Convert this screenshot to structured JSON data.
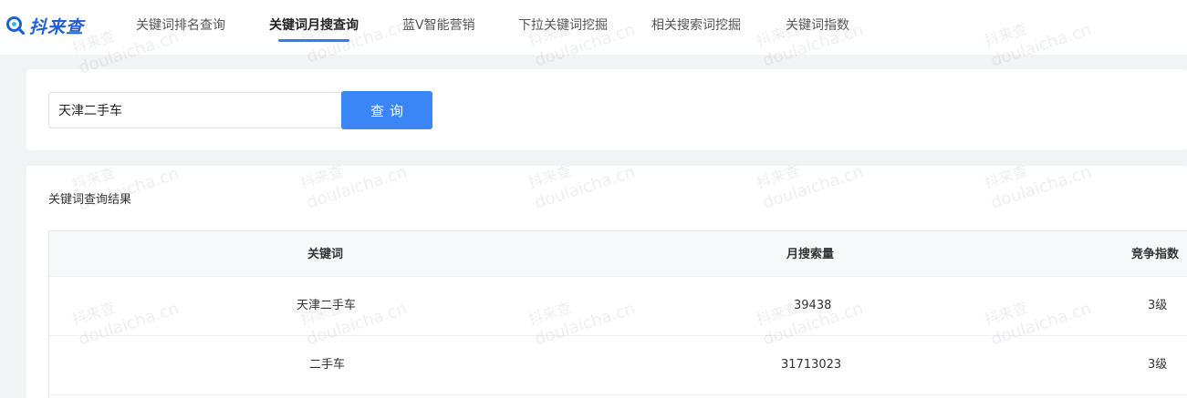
{
  "header": {
    "logo_text": "抖来查",
    "nav": [
      {
        "label": "关键词排名查询",
        "active": false
      },
      {
        "label": "关键词月搜查询",
        "active": true
      },
      {
        "label": "蓝V智能营销",
        "active": false
      },
      {
        "label": "下拉关键词挖掘",
        "active": false
      },
      {
        "label": "相关搜索词挖掘",
        "active": false
      },
      {
        "label": "关键词指数",
        "active": false
      }
    ]
  },
  "search": {
    "value": "天津二手车",
    "button_label": "查询"
  },
  "results": {
    "title": "关键词查询结果",
    "columns": [
      "关键词",
      "月搜索量",
      "竞争指数"
    ],
    "rows": [
      {
        "keyword": "天津二手车",
        "monthly_search": "39438",
        "competition": "3级"
      },
      {
        "keyword": "二手车",
        "monthly_search": "31713023",
        "competition": "3级"
      }
    ]
  },
  "watermark": {
    "cn": "抖来查",
    "en": "doulaicha.cn"
  },
  "colors": {
    "accent": "#3a86f7",
    "logo": "#1e5fd6",
    "background": "#f2f3f5"
  }
}
